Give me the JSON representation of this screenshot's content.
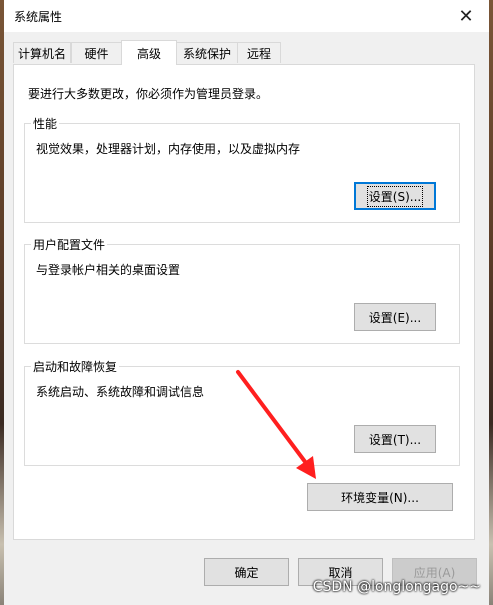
{
  "window": {
    "title": "系统属性"
  },
  "tabs": [
    {
      "label": "计算机名",
      "active": false
    },
    {
      "label": "硬件",
      "active": false
    },
    {
      "label": "高级",
      "active": true
    },
    {
      "label": "系统保护",
      "active": false
    },
    {
      "label": "远程",
      "active": false
    }
  ],
  "admin_note": "要进行大多数更改，你必须作为管理员登录。",
  "performance": {
    "label": "性能",
    "description": "视觉效果，处理器计划，内存使用，以及虚拟内存",
    "button": "设置(S)..."
  },
  "user_profiles": {
    "label": "用户配置文件",
    "description": "与登录帐户相关的桌面设置",
    "button": "设置(E)..."
  },
  "startup_recovery": {
    "label": "启动和故障恢复",
    "description": "系统启动、系统故障和调试信息",
    "button": "设置(T)..."
  },
  "env_button": "环境变量(N)...",
  "footer": {
    "ok": "确定",
    "cancel": "取消",
    "apply": "应用(A)"
  },
  "watermark": "CSDN @longlongago~~",
  "colors": {
    "arrow": "#ff1f1f",
    "focus": "#0078d7"
  }
}
